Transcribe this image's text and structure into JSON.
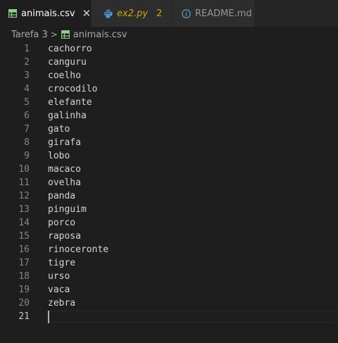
{
  "tabs": [
    {
      "label": "animais.csv",
      "icon": "csv-table-icon",
      "active": true,
      "close": "✕"
    },
    {
      "label": "ex2.py",
      "icon": "python-icon",
      "badge": "2"
    },
    {
      "label": "README.md",
      "icon": "info-icon"
    }
  ],
  "breadcrumb": {
    "folder": "Tarefa 3",
    "separator": ">",
    "file": "animais.csv"
  },
  "editor": {
    "lines": [
      {
        "n": "1",
        "text": "cachorro"
      },
      {
        "n": "2",
        "text": "canguru"
      },
      {
        "n": "3",
        "text": "coelho"
      },
      {
        "n": "4",
        "text": "crocodilo"
      },
      {
        "n": "5",
        "text": "elefante"
      },
      {
        "n": "6",
        "text": "galinha"
      },
      {
        "n": "7",
        "text": "gato"
      },
      {
        "n": "8",
        "text": "girafa"
      },
      {
        "n": "9",
        "text": "lobo"
      },
      {
        "n": "10",
        "text": "macaco"
      },
      {
        "n": "11",
        "text": "ovelha"
      },
      {
        "n": "12",
        "text": "panda"
      },
      {
        "n": "13",
        "text": "pinguim"
      },
      {
        "n": "14",
        "text": "porco"
      },
      {
        "n": "15",
        "text": "raposa"
      },
      {
        "n": "16",
        "text": "rinoceronte"
      },
      {
        "n": "17",
        "text": "tigre"
      },
      {
        "n": "18",
        "text": "urso"
      },
      {
        "n": "19",
        "text": "vaca"
      },
      {
        "n": "20",
        "text": "zebra"
      },
      {
        "n": "21",
        "text": ""
      }
    ],
    "current_line": "21"
  },
  "colors": {
    "background": "#1e1e1e",
    "tabbar": "#252526",
    "csv_icon": "#89d185",
    "python_icon": "#3c78aa",
    "modified": "#cca700",
    "line_number": "#858585",
    "text": "#d4d4d4"
  }
}
